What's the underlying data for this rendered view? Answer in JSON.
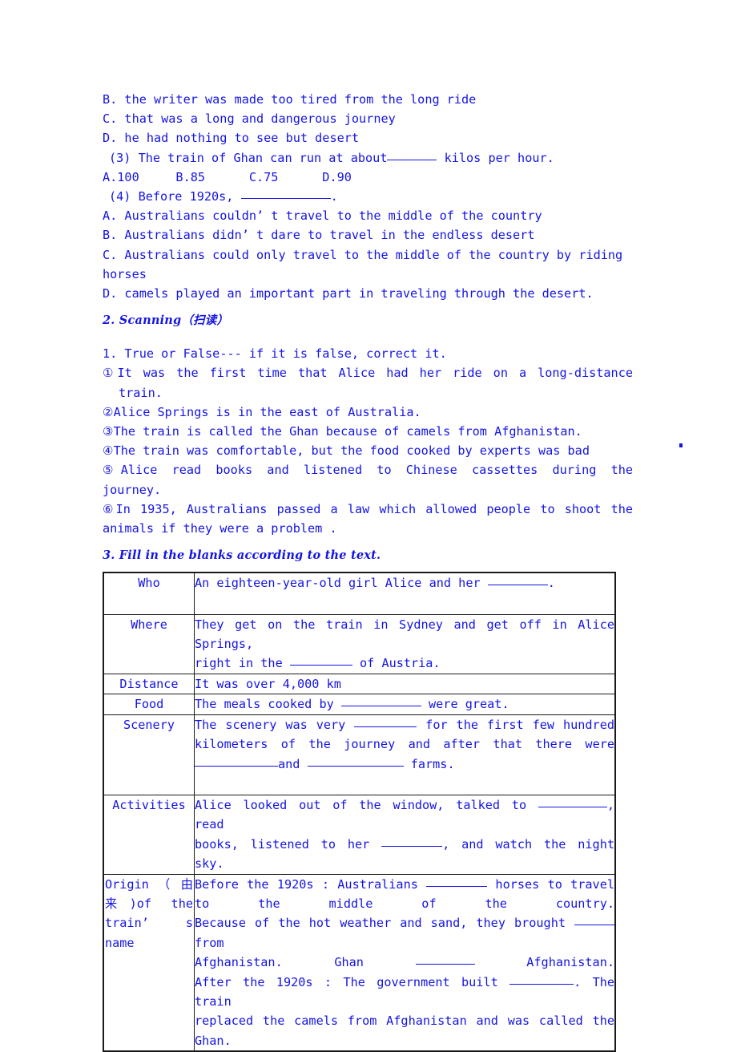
{
  "document": {
    "text_color": "#1414e6",
    "border_color": "#1a1a1a",
    "stray_mark": "."
  },
  "mcq_continued": {
    "options_q2": [
      "B. the writer was made too tired from the long ride",
      "C. that was a long and dangerous journey",
      "D. he had nothing to see but desert"
    ],
    "q3": {
      "stem_before": "(3) The train of Ghan can run at about",
      "stem_after": " kilos per hour.",
      "options_line": "A.100     B.85      C.75      D.90"
    },
    "q4": {
      "stem_before": "(4) Before 1920s, ",
      "stem_after": ".",
      "options": [
        "A. Australians couldn’ t travel to the middle of the country",
        "B. Australians didn’ t dare to travel in the endless desert",
        "C. Australians could only travel to the middle of the country by riding",
        "horses",
        "D. camels played an important part in traveling through the desert."
      ]
    }
  },
  "section_scanning": {
    "heading": "2. Scanning（扫读）",
    "instruction": "1. True or False--- if it is false, correct it.",
    "statements": [
      {
        "marker": "①",
        "text_1": "It was the first time that Alice had her ride on a long-distance",
        "text_2": "train."
      },
      {
        "marker": "②",
        "text_1": "Alice Springs is in the east of Australia.",
        "text_2": ""
      },
      {
        "marker": "③",
        "text_1": "The train is called the Ghan because of camels from Afghanistan.",
        "text_2": ""
      },
      {
        "marker": "④",
        "text_1": "The train was comfortable, but the food cooked by experts was bad",
        "text_2": ""
      },
      {
        "marker": "⑤",
        "text_1": "Alice read books and listened to Chinese cassettes during the",
        "text_2": "journey."
      },
      {
        "marker": "⑥",
        "text_1": "In 1935, Australians passed a law which allowed people to shoot the",
        "text_2": "animals if they were a problem ."
      }
    ]
  },
  "section_fill": {
    "heading": "3. Fill in the blanks according to the text.",
    "rows": [
      {
        "label": "Who",
        "lines": [
          [
            {
              "t": "An eighteen-year-old girl Alice and her "
            },
            {
              "b": 75
            },
            {
              "t": "."
            }
          ]
        ],
        "trailing_space": true,
        "justify_last": false
      },
      {
        "label": "Where",
        "lines": [
          [
            {
              "t": "They get on the train in Sydney and get off in Alice Springs,"
            }
          ],
          [
            {
              "t": "right in the "
            },
            {
              "b": 78
            },
            {
              "t": " of Austria."
            }
          ]
        ],
        "trailing_space": false,
        "justify_last": false
      },
      {
        "label": "Distance",
        "lines": [
          [
            {
              "t": "It was over 4,000 km"
            }
          ]
        ],
        "trailing_space": false,
        "justify_last": false
      },
      {
        "label": "Food",
        "lines": [
          [
            {
              "t": "The meals cooked by "
            },
            {
              "b": 100
            },
            {
              "t": " were great."
            }
          ]
        ],
        "trailing_space": false,
        "justify_last": false
      },
      {
        "label": "Scenery",
        "lines": [
          [
            {
              "t": "The scenery was very "
            },
            {
              "b": 78
            },
            {
              "t": " for the first few hundred"
            }
          ],
          [
            {
              "t": "kilometers of the journey and after that there were"
            }
          ],
          [
            {
              "b": 104
            },
            {
              "t": "and "
            },
            {
              "b": 120
            },
            {
              "t": " farms."
            }
          ]
        ],
        "trailing_space": true,
        "justify_last": false
      },
      {
        "label": "Activities",
        "lines": [
          [
            {
              "t": "Alice looked out of the window, talked to "
            },
            {
              "b": 86
            },
            {
              "t": ", read"
            }
          ],
          [
            {
              "t": "books, listened to her "
            },
            {
              "b": 76
            },
            {
              "t": ", and watch the night sky."
            }
          ]
        ],
        "trailing_space": false,
        "justify_last": false
      },
      {
        "label": "Origin （ 由来)of the train’ s name",
        "label_wrap": true,
        "lines": [
          [
            {
              "t": "Before the 1920s  : Australians "
            },
            {
              "b": 76
            },
            {
              "t": " horses to  travel"
            }
          ],
          [
            {
              "t": "to the middle of the country."
            }
          ],
          [
            {
              "t": "Because of the hot weather and sand, they brought "
            },
            {
              "b": 50
            },
            {
              "t": " from"
            }
          ],
          [
            {
              "t": "Afghanistan. Ghan "
            },
            {
              "b": 74
            },
            {
              "t": " Afghanistan."
            }
          ],
          [
            {
              "t": "After the 1920s : The government built "
            },
            {
              "b": 80
            },
            {
              "t": ". The train"
            }
          ],
          [
            {
              "t": "replaced the camels from Afghanistan and was called the"
            }
          ],
          [
            {
              "t": "Ghan."
            }
          ]
        ],
        "trailing_space": false,
        "justify_last": false
      }
    ]
  }
}
